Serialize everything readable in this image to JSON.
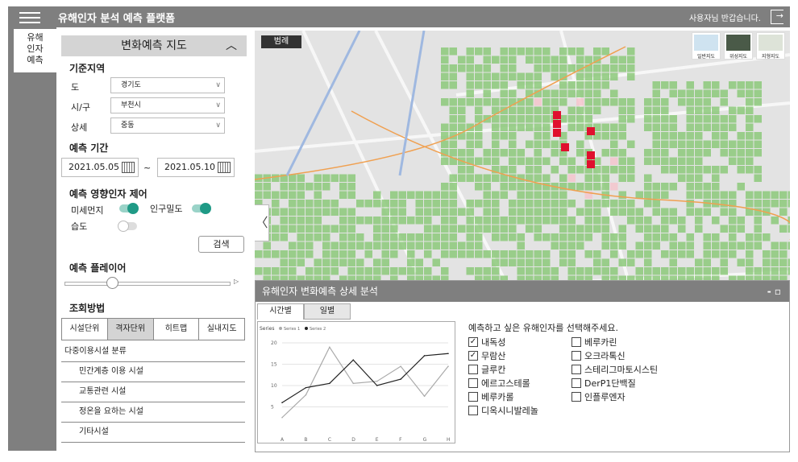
{
  "header": {
    "title": "유해인자 분석 예측 플랫폼",
    "welcome": "사용자님 반갑습니다."
  },
  "side_tab": {
    "lines": [
      "유해",
      "인자",
      "예측"
    ]
  },
  "panel": {
    "title": "변화예측 지도",
    "region_section": "기준지역",
    "fields": [
      {
        "label": "도",
        "value": "경기도"
      },
      {
        "label": "시/구",
        "value": "부천시"
      },
      {
        "label": "상세",
        "value": "중동"
      }
    ],
    "period_section": "예측 기간",
    "date_start": "2021.05.05",
    "date_sep": "~",
    "date_end": "2021.05.10",
    "factor_section": "예측 영향인자 제어",
    "toggles": [
      {
        "label": "미세먼지",
        "on": true
      },
      {
        "label": "인구밀도",
        "on": true
      },
      {
        "label": "습도",
        "on": false
      }
    ],
    "search_label": "검색",
    "player_section": "예측 플레이어",
    "player_position": 0.28,
    "method_section": "조회방법",
    "method_tabs": [
      "시설단위",
      "격자단위",
      "히트맵",
      "실내지도"
    ],
    "active_tab": 1,
    "categories": [
      "다중이용시설 분류",
      "민간계층 이용 시설",
      "교통관련 시설",
      "정온을 요하는 시설",
      "기타시설"
    ]
  },
  "map": {
    "legend_label": "범례",
    "map_types": [
      "일반지도",
      "위성지도",
      "지형지도"
    ],
    "colors": {
      "grid_green": "#8cc97a",
      "light_pink": "#f4c6cc",
      "red": "#e0102e"
    }
  },
  "detail": {
    "title": "유해인자 변화예측 상세 분석",
    "tabs": [
      "시간별",
      "일별"
    ],
    "active_tab": 0,
    "prompt": "예측하고 싶은 유해인자를 선택해주세요.",
    "factors": [
      {
        "label": "내독성",
        "checked": true
      },
      {
        "label": "무람산",
        "checked": true
      },
      {
        "label": "글루칸",
        "checked": false
      },
      {
        "label": "에르고스테롤",
        "checked": false
      },
      {
        "label": "베루카롤",
        "checked": false
      },
      {
        "label": "디옥시니발레놀",
        "checked": false
      },
      {
        "label": "베루카린",
        "checked": false
      },
      {
        "label": "오크라톡신",
        "checked": false
      },
      {
        "label": "스테리그마토시스틴",
        "checked": false
      },
      {
        "label": "DerP1단백질",
        "checked": false
      },
      {
        "label": "인플루엔자",
        "checked": false
      }
    ]
  },
  "chart_data": {
    "type": "line",
    "title": "Series",
    "categories": [
      "A",
      "B",
      "C",
      "D",
      "E",
      "F",
      "G",
      "H"
    ],
    "ylim": [
      0,
      20
    ],
    "yticks": [
      5,
      10,
      15,
      20
    ],
    "legend": "top",
    "series": [
      {
        "name": "Series 1",
        "color": "#aaaaaa",
        "values": [
          2.5,
          7.8,
          19,
          10.5,
          11,
          14.5,
          7.5,
          14.5
        ]
      },
      {
        "name": "Series 2",
        "color": "#222222",
        "values": [
          6,
          9.5,
          10.5,
          16,
          10,
          11.5,
          17,
          17.5
        ]
      }
    ]
  }
}
